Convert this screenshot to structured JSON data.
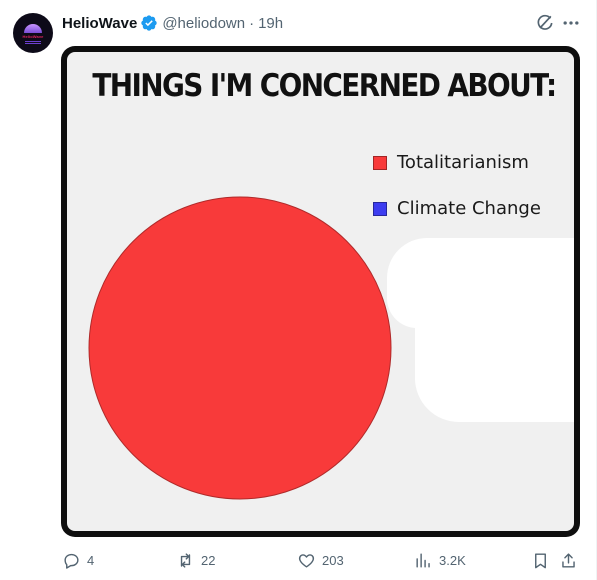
{
  "post": {
    "author": {
      "name": "HelioWave",
      "handle": "@heliodown",
      "avatar_text": "HelioWave"
    },
    "separator": "·",
    "time": "19h",
    "media": {
      "title": "THINGS I'M CONCERNED ABOUT:",
      "chart_data": {
        "type": "pie",
        "title": "THINGS I'M CONCERNED ABOUT:",
        "categories": [
          "Totalitarianism",
          "Climate Change"
        ],
        "values": [
          100,
          0
        ],
        "colors": [
          "#f83a3a",
          "#3d3df0"
        ],
        "legend_position": "top-right"
      }
    },
    "actions": {
      "replies": "4",
      "reposts": "22",
      "likes": "203",
      "views": "3.2K"
    }
  },
  "colors": {
    "text_primary": "#0f1419",
    "text_secondary": "#536471",
    "verified_blue": "#1d9bf0"
  },
  "icons": [
    "verified-badge-icon",
    "grok-icon",
    "more-icon",
    "reply-icon",
    "repost-icon",
    "like-icon",
    "views-icon",
    "bookmark-icon",
    "share-icon"
  ]
}
